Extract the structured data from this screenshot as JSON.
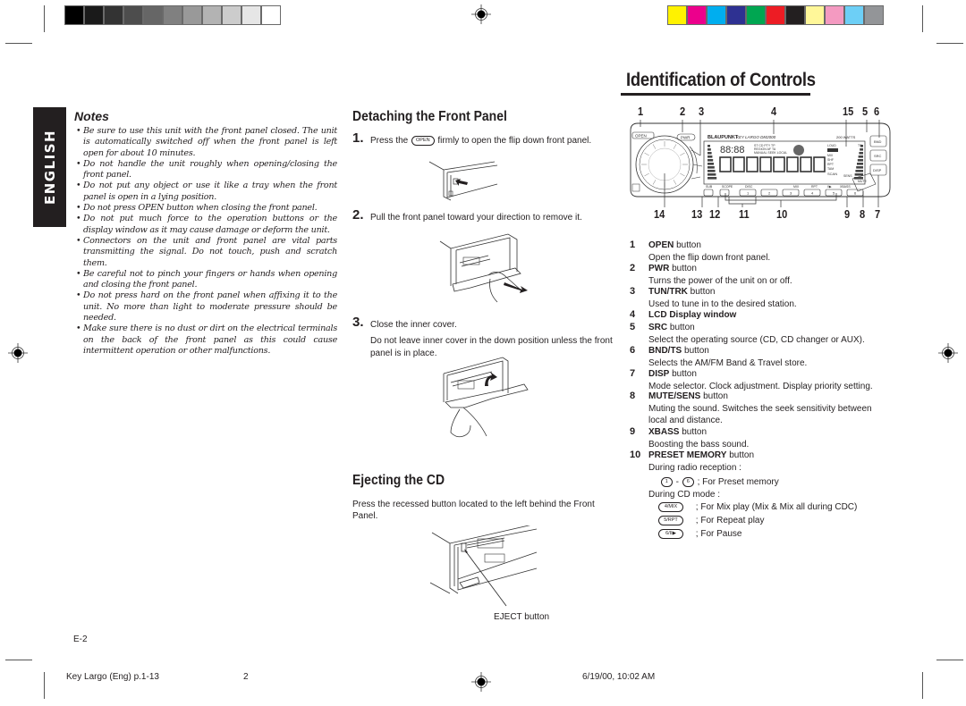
{
  "print_marks": {
    "gray_swatches": [
      "#000000",
      "#1a1a1a",
      "#333333",
      "#4d4d4d",
      "#666666",
      "#808080",
      "#999999",
      "#b3b3b3",
      "#cccccc",
      "#e6e6e6",
      "#ffffff"
    ],
    "color_swatches": [
      "#fff200",
      "#ec008c",
      "#00aeef",
      "#2e3192",
      "#00a651",
      "#ed1c24",
      "#231f20",
      "#fff799",
      "#f49ac1",
      "#6dcff6",
      "#939598"
    ]
  },
  "header": {
    "title": "Identification of Controls"
  },
  "language_tab": "ENGLISH",
  "notes": {
    "heading": "Notes",
    "items": [
      "Be sure to use this unit with the front panel closed. The unit is automatically switched off when the front panel is left open for about 10 minutes.",
      "Do not handle the unit roughly when opening/closing the front panel.",
      "Do not put any object or use it like a tray when the front panel is open in a lying position.",
      "Do not press OPEN button when closing the front panel.",
      "Do not put much force to the operation buttons or the display window as it may cause damage or deform the unit.",
      "Connectors on the unit and front panel are vital parts transmitting the signal. Do not touch, push and scratch them.",
      "Be careful not to pinch your fingers or hands when opening and closing the front panel.",
      "Do not press hard on the front panel when affixing it to the unit. No more than light to moderate pressure should be needed.",
      "Make sure there is no dust or dirt on the electrical terminals on the back of the front panel as this could cause intermittent operation or other malfunctions."
    ]
  },
  "detaching": {
    "heading": "Detaching the Front Panel",
    "steps": [
      {
        "num": "1.",
        "text_before": "Press the",
        "key": "OPEN",
        "text_after": "firmly to open the flip down front panel."
      },
      {
        "num": "2.",
        "text": "Pull the front panel toward your direction to remove it."
      },
      {
        "num": "3.",
        "text": "Close the inner cover.",
        "note": "Do not leave inner cover in the down position unless the front panel is in place."
      }
    ]
  },
  "ejecting": {
    "heading": "Ejecting the CD",
    "text": "Press the recessed button located to the left behind the Front Panel.",
    "callout": "EJECT button"
  },
  "diagram": {
    "top_callouts": [
      "1",
      "2",
      "3",
      "4",
      "15",
      "5",
      "6"
    ],
    "bottom_callouts": [
      "14",
      "13",
      "12",
      "11",
      "10",
      "9",
      "8",
      "7"
    ],
    "brand": "BLAUPUNKT",
    "model": "KEY LARGO DM2000",
    "power_label": "200 WATTS",
    "lcd_digits": "88:88",
    "lcd_indicators": [
      "ST",
      "CD",
      "PTY",
      "TP",
      "REGION",
      "AF",
      "TA",
      "MANUAL",
      "SEEK",
      "LOCAL",
      "LOUD",
      "MIX",
      "SHF",
      "RPT",
      "TAM",
      "SCAN"
    ],
    "buttons": {
      "open": "OPEN",
      "pwr": "PWR",
      "bnd": "BND",
      "src": "SRC",
      "disp": "DISP",
      "ts": "TS",
      "mute": "MUTE",
      "sens": "SENS",
      "sub": "SUB",
      "scope": "SCOPE",
      "disc": "DISC",
      "mix": "MIX",
      "rpt": "RPT",
      "pause": "II▶",
      "xbass": "XBASS",
      "presets": [
        "1",
        "2",
        "3",
        "4",
        "5",
        "6"
      ]
    }
  },
  "controls": [
    {
      "num": "1",
      "name_bold": "OPEN",
      "name_rest": " button",
      "desc": "Open the flip down front panel."
    },
    {
      "num": "2",
      "name_bold": "PWR",
      "name_rest": " button",
      "desc": "Turns the power of the unit on or off."
    },
    {
      "num": "3",
      "name_bold": "TUN/TRK",
      "name_rest": " button",
      "desc": "Used to tune in to the desired station."
    },
    {
      "num": "4",
      "name_bold": "LCD Display window",
      "name_rest": "",
      "desc": ""
    },
    {
      "num": "5",
      "name_bold": "SRC",
      "name_rest": " button",
      "desc": "Select the operating source (CD, CD changer or AUX)."
    },
    {
      "num": "6",
      "name_bold": "BND/TS",
      "name_rest": " button",
      "desc": "Selects the AM/FM Band & Travel store."
    },
    {
      "num": "7",
      "name_bold": "DISP",
      "name_rest": " button",
      "desc": "Mode selector. Clock adjustment. Display priority setting."
    },
    {
      "num": "8",
      "name_bold": "MUTE/SENS",
      "name_rest": " button",
      "desc": "Muting the sound. Switches the seek sensitivity between local and distance."
    },
    {
      "num": "9",
      "name_bold": "XBASS",
      "name_rest": " button",
      "desc": "Boosting the bass sound."
    },
    {
      "num": "10",
      "name_bold": "PRESET MEMORY",
      "name_rest": " button",
      "desc": "During radio reception :"
    }
  ],
  "preset_details": {
    "radio_keys": [
      "1",
      "6"
    ],
    "radio_desc": "; For Preset memory",
    "cd_mode_label": "During CD mode :",
    "cd_items": [
      {
        "key": "4/MIX",
        "desc": "; For Mix play (Mix & Mix all during CDC)"
      },
      {
        "key": "5/RPT",
        "desc": "; For Repeat play"
      },
      {
        "key": "6/II▶",
        "desc": "; For Pause"
      }
    ]
  },
  "footer": {
    "page_number": "E-2",
    "file_name": "Key Largo (Eng) p.1-13",
    "sheet": "2",
    "timestamp": "6/19/00, 10:02 AM"
  }
}
